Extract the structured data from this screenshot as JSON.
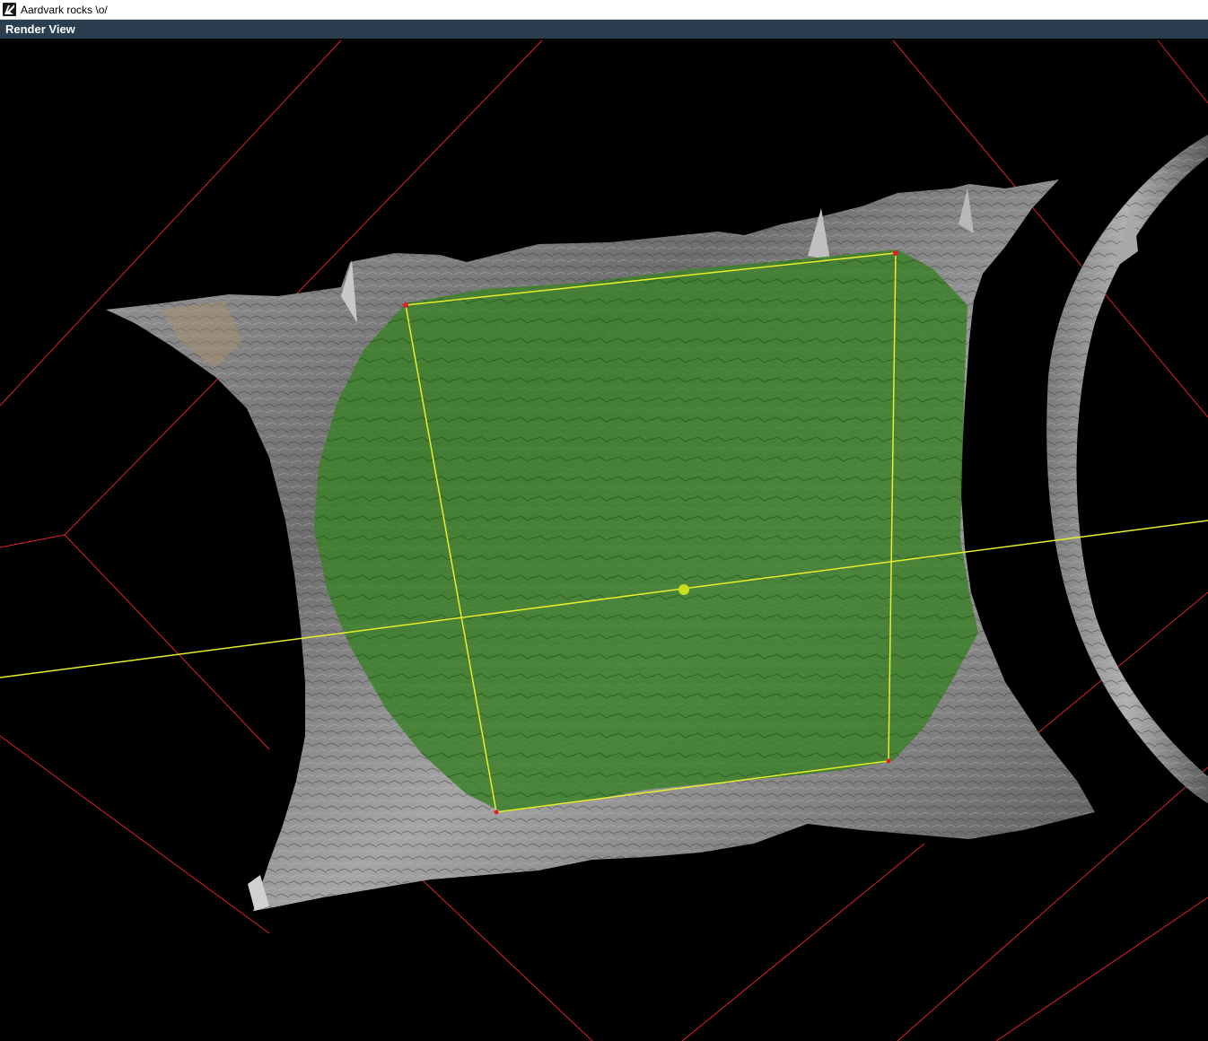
{
  "window": {
    "title": "Aardvark rocks \\o/",
    "icon": "aardvark-logo-icon"
  },
  "panel": {
    "title": "Render View"
  },
  "scene": {
    "grid_color": "#e0202a",
    "selection_color": "#4a8a2a",
    "outline_color": "#e8ef2a",
    "vertex_color": "#e02020",
    "rock_color": "#8a8a8a",
    "background_color": "#000000"
  }
}
